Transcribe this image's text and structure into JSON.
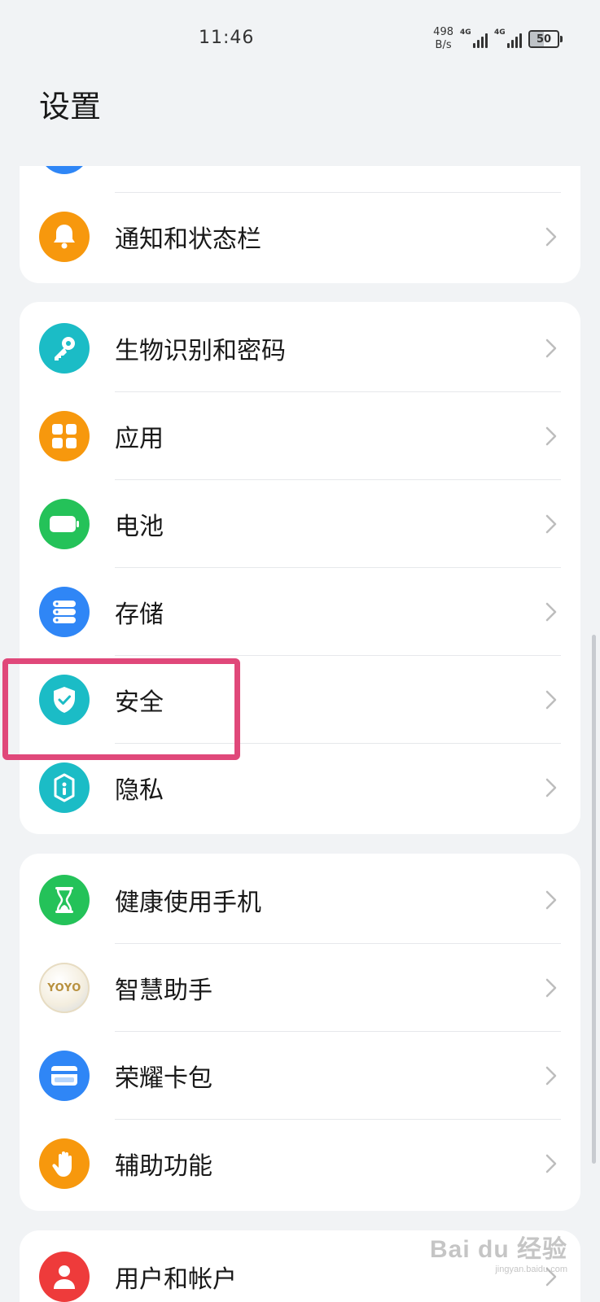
{
  "status_bar": {
    "time": "11:46",
    "net_speed_value": "498",
    "net_speed_unit": "B/s",
    "signal_1_label": "4G",
    "signal_2_label": "4G",
    "battery_level": "50"
  },
  "page": {
    "title": "设置"
  },
  "card_top": {
    "items": [
      {
        "label": "通知和状态栏",
        "icon": "bell-icon",
        "color": "#f7980d"
      }
    ]
  },
  "card_security": {
    "items": [
      {
        "label": "生物识别和密码",
        "icon": "key-icon",
        "color": "#1bbcc6"
      },
      {
        "label": "应用",
        "icon": "apps-grid-icon",
        "color": "#f7980d"
      },
      {
        "label": "电池",
        "icon": "battery-icon",
        "color": "#24c259"
      },
      {
        "label": "存储",
        "icon": "storage-icon",
        "color": "#2f86f6"
      },
      {
        "label": "安全",
        "icon": "shield-check-icon",
        "color": "#1bbcc6"
      },
      {
        "label": "隐私",
        "icon": "privacy-lock-icon",
        "color": "#1bbcc6"
      }
    ]
  },
  "card_assist": {
    "items": [
      {
        "label": "健康使用手机",
        "icon": "hourglass-icon",
        "color": "#24c259"
      },
      {
        "label": "智慧助手",
        "icon": "yoyo-assistant-icon",
        "color": "#f2ead8",
        "badge_text": "YOYO"
      },
      {
        "label": "荣耀卡包",
        "icon": "wallet-card-icon",
        "color": "#2f86f6"
      },
      {
        "label": "辅助功能",
        "icon": "hand-icon",
        "color": "#f7980d"
      }
    ]
  },
  "card_bottom": {
    "items": [
      {
        "label": "用户和帐户",
        "icon": "user-icon",
        "color": "#ee3b3b"
      }
    ]
  },
  "watermark": {
    "main": "Bai du 经验",
    "sub": "jingyan.baidu.com"
  }
}
